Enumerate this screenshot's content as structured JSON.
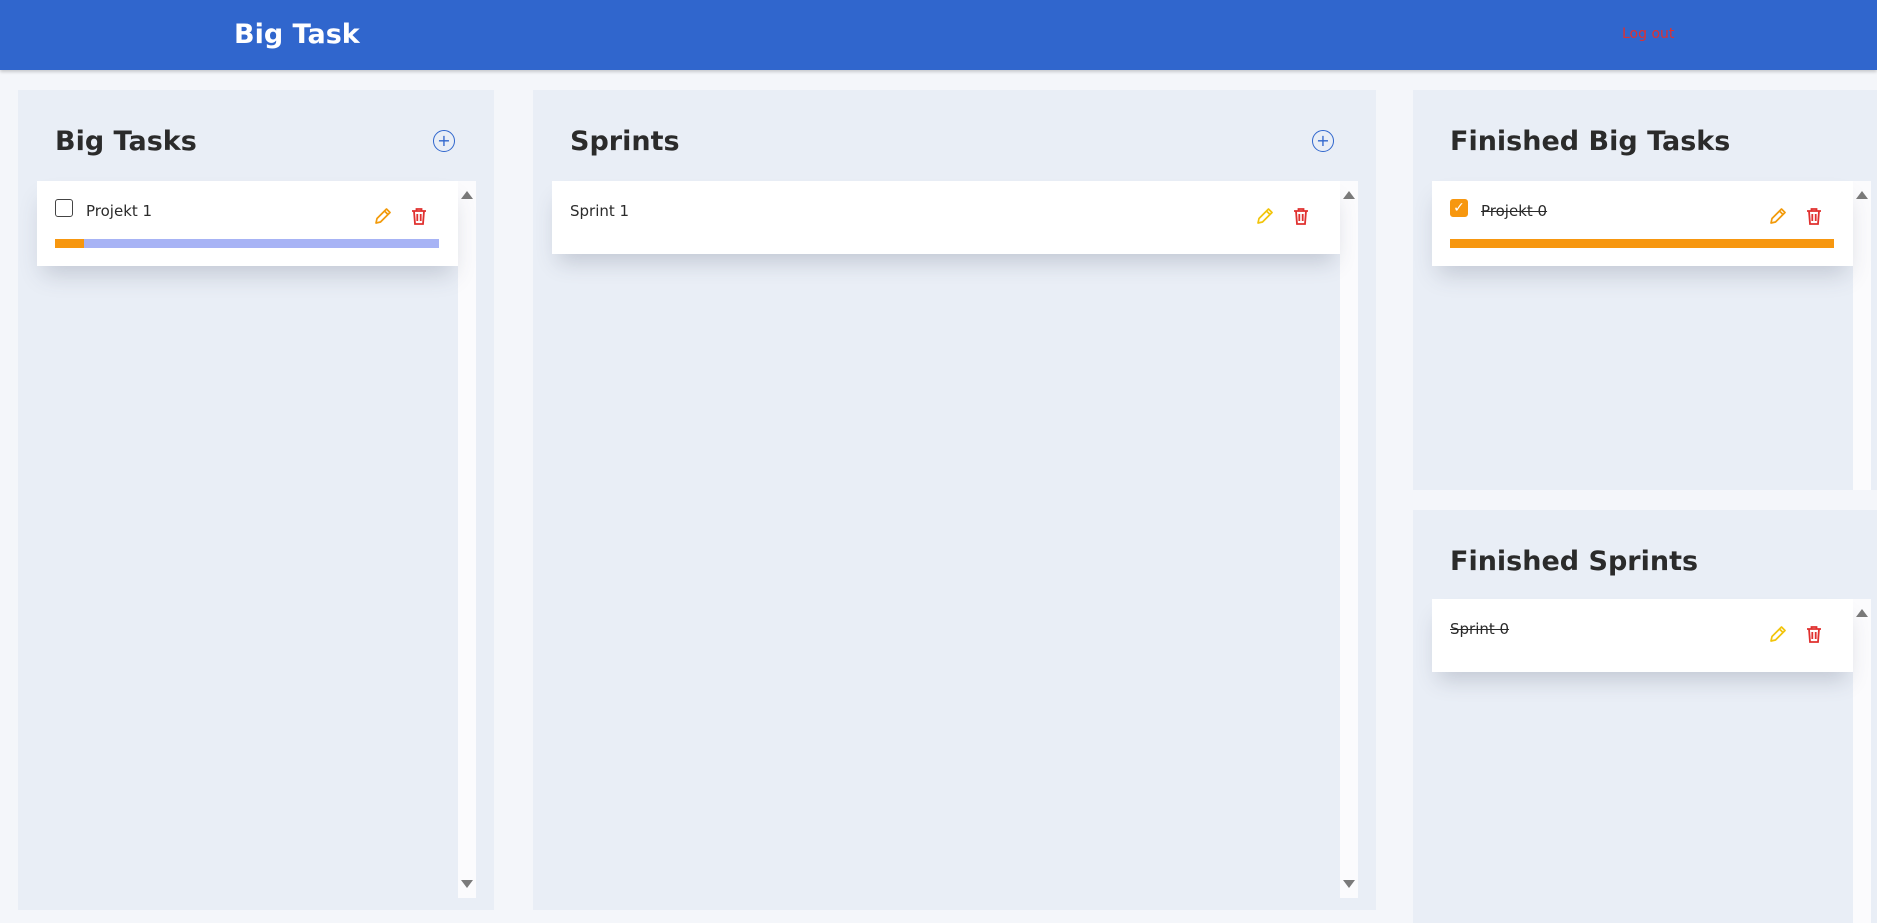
{
  "header": {
    "title": "Big Task",
    "logout_label": "Log out"
  },
  "icons": {
    "add": "plus-circle-icon",
    "edit": "pencil-icon",
    "delete": "trash-icon",
    "check": "checkmark-icon"
  },
  "colors": {
    "header": "#3066cd",
    "accent": "#f7970f",
    "progress_track": "#a7b3f5",
    "delete": "#e0302f",
    "edit": "#f2b705"
  },
  "columns": {
    "big_tasks": {
      "title": "Big Tasks",
      "add_symbol": "+",
      "items": [
        {
          "label": "Projekt 1",
          "checked": false,
          "progress": 0.075
        }
      ]
    },
    "sprints": {
      "title": "Sprints",
      "add_symbol": "+",
      "items": [
        {
          "label": "Sprint 1"
        }
      ]
    },
    "finished_big_tasks": {
      "title": "Finished Big Tasks",
      "items": [
        {
          "label": "Projekt 0",
          "checked": true,
          "check_symbol": "✓",
          "progress": 1.0
        }
      ]
    },
    "finished_sprints": {
      "title": "Finished Sprints",
      "items": [
        {
          "label": "Sprint 0"
        }
      ]
    }
  }
}
